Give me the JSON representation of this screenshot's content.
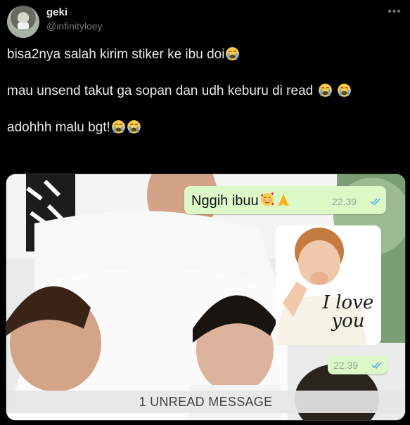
{
  "user": {
    "display_name": "geki",
    "handle": "@infinityloey"
  },
  "tweet": {
    "line1": "bisa2nya salah kirim stiker ke ibu doi",
    "line2": "mau unsend takut ga sopan dan udh keburu di read ",
    "line3": "adohhh malu bgt!"
  },
  "icons": {
    "crying": "loudly-crying-face-emoji",
    "hearts": "smiling-face-with-hearts-emoji",
    "pray": "folded-hands-emoji",
    "more": "more-icon",
    "ticks": "double-check-icon"
  },
  "chat": {
    "message_text": "Nggih ibuu",
    "message_time": "22.39",
    "sticker_time": "22.39",
    "sticker_caption_1": "I love",
    "sticker_caption_2": "you",
    "unread_banner": "1 UNREAD MESSAGE"
  },
  "colors": {
    "background": "#000000",
    "text": "#e7e9ea",
    "secondary": "#71767b",
    "bubble": "#dcf8c6",
    "read_ticks": "#4fb6ec"
  }
}
